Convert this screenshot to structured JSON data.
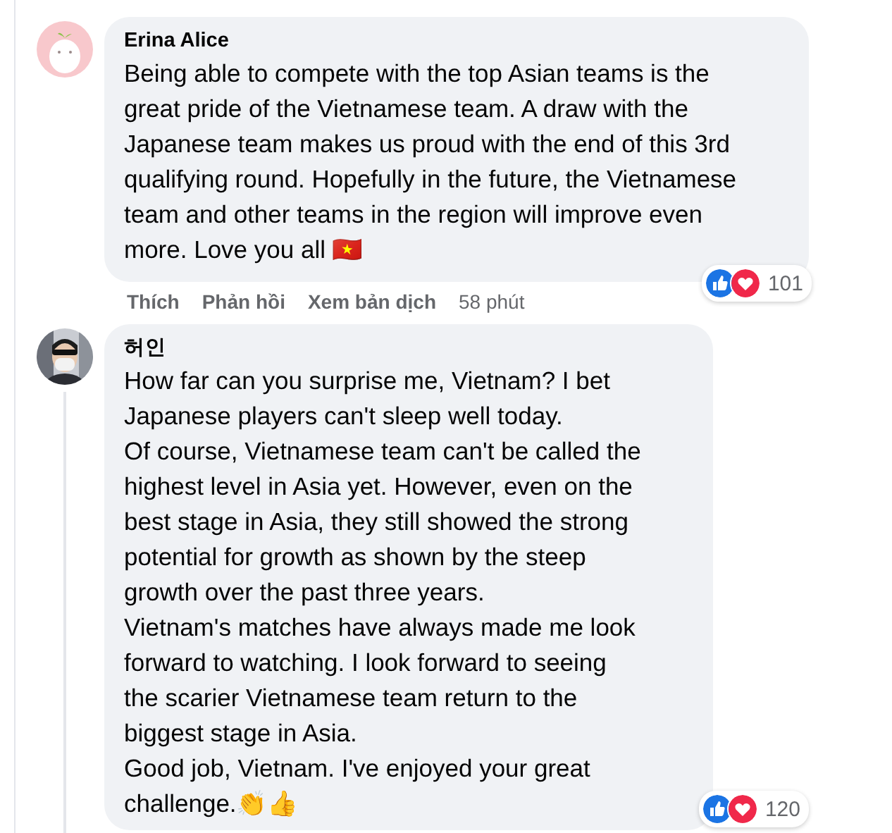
{
  "comments": [
    {
      "author": "Erina Alice",
      "avatar": {
        "kind": "drawing"
      },
      "paragraphs": [
        "Being able to compete with the top Asian teams is the great pride of the Vietnamese team. A draw with the Japanese team makes us proud with the end of this 3rd qualifying round. Hopefully in the future, the Vietnamese team and other teams in the region will improve even more. Love you all 🇻🇳"
      ],
      "actions": [
        "Thích",
        "Phản hồi",
        "Xem bản dịch"
      ],
      "time": "58 phút",
      "reaction_count": "101"
    },
    {
      "author": "허인",
      "paragraphs": [
        "How far can you surprise me, Vietnam? I bet Japanese players can't sleep well today.",
        "Of course, Vietnamese team can't be called the highest level in Asia yet. However, even on the best stage in Asia, they still showed the strong potential for growth as shown by the steep growth over the past three years.",
        "Vietnam's matches have always made me look forward to watching. I look forward to seeing the scarier Vietnamese team return to the biggest stage in Asia.",
        "Good job, Vietnam. I've enjoyed your great challenge.👏👍"
      ],
      "reaction_count": "120"
    }
  ]
}
